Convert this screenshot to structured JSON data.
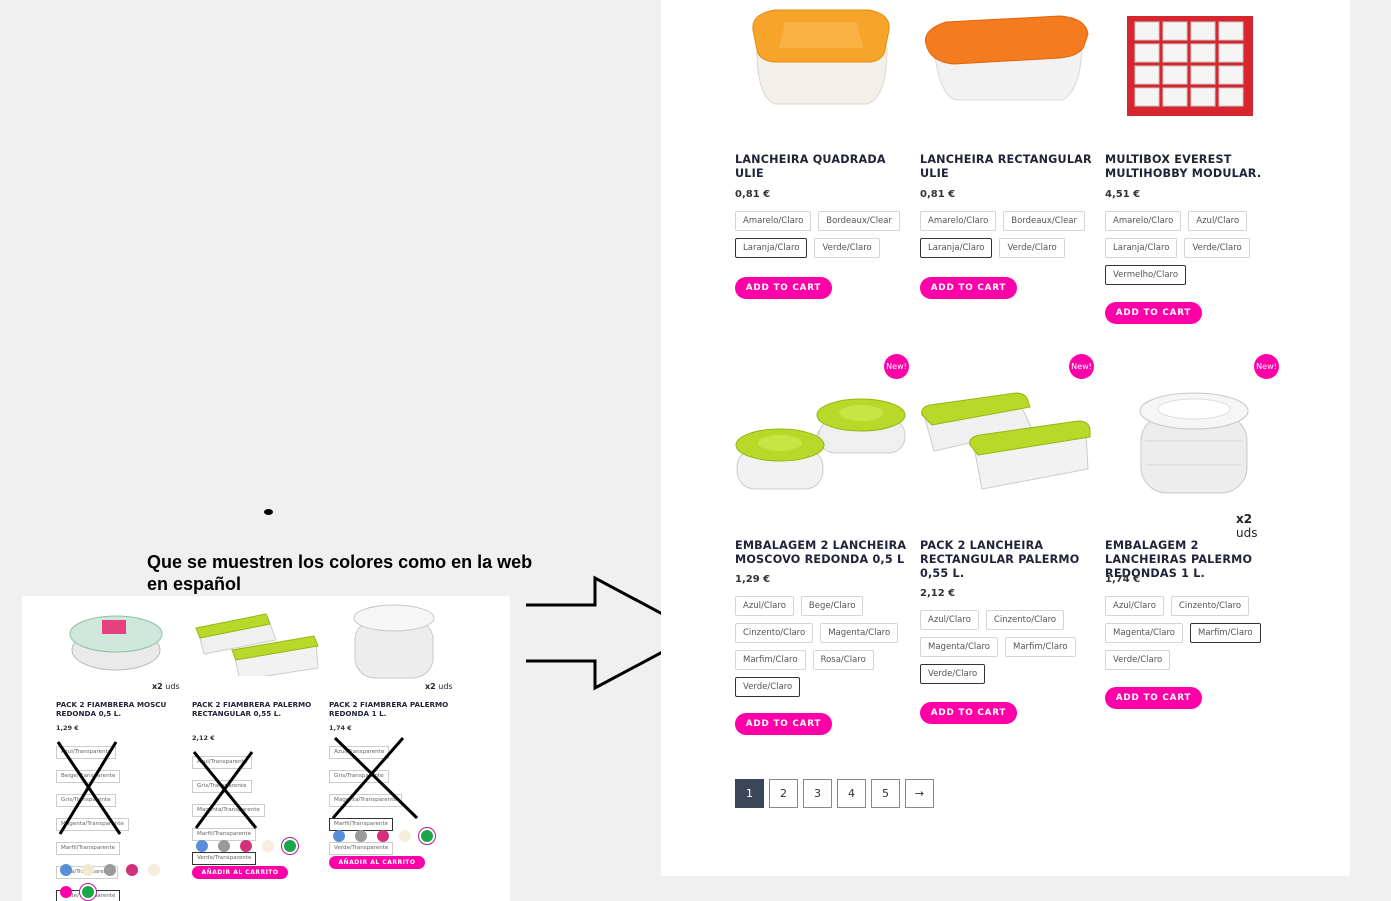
{
  "annotation": {
    "note": "Que se muestren los colores como en la web en español"
  },
  "products": [
    {
      "title": "LANCHEIRA QUADRADA ULIE",
      "price": "0,81 €",
      "colors": [
        "Amarelo/Claro",
        "Bordeaux/Clear",
        "Laranja/Claro",
        "Verde/Claro"
      ],
      "selected": "Laranja/Claro",
      "button": "ADD TO CART",
      "badge": ""
    },
    {
      "title": "LANCHEIRA RECTANGULAR ULIE",
      "price": "0,81 €",
      "colors": [
        "Amarelo/Claro",
        "Bordeaux/Clear",
        "Laranja/Claro",
        "Verde/Claro"
      ],
      "selected": "Laranja/Claro",
      "button": "ADD TO CART",
      "badge": ""
    },
    {
      "title": "MULTIBOX EVEREST MULTIHOBBY MODULAR.",
      "price": "4,51 €",
      "colors": [
        "Amarelo/Claro",
        "Azul/Claro",
        "Laranja/Claro",
        "Verde/Claro",
        "Vermelho/Claro"
      ],
      "selected": "Vermelho/Claro",
      "button": "ADD TO CART",
      "badge": ""
    },
    {
      "title": "EMBALAGEM 2 LANCHEIRA MOSCOVO REDONDA 0,5 L",
      "price": "1,29 €",
      "colors": [
        "Azul/Claro",
        "Bege/Claro",
        "Cinzento/Claro",
        "Magenta/Claro",
        "Marfim/Claro",
        "Rosa/Claro",
        "Verde/Claro"
      ],
      "selected": "Verde/Claro",
      "button": "ADD TO CART",
      "badge": "New!"
    },
    {
      "title": "PACK 2 LANCHEIRA RECTANGULAR PALERMO 0,55 L.",
      "price": "2,12 €",
      "colors": [
        "Azul/Claro",
        "Cinzento/Claro",
        "Magenta/Claro",
        "Marfim/Claro",
        "Verde/Claro"
      ],
      "selected": "Verde/Claro",
      "button": "ADD TO CART",
      "badge": "New!"
    },
    {
      "title": "EMBALAGEM 2 LANCHEIRAS PALERMO REDONDAS 1 L.",
      "price": "1,74 €",
      "colors": [
        "Azul/Claro",
        "Cinzento/Claro",
        "Magenta/Claro",
        "Marfim/Claro",
        "Verde/Claro"
      ],
      "selected": "Marfim/Claro",
      "button": "ADD TO CART",
      "badge": "New!",
      "uds_qty": "x2",
      "uds_unit": "uds"
    }
  ],
  "pagination": [
    "1",
    "2",
    "3",
    "4",
    "5",
    "→"
  ],
  "pagination_current": "1",
  "spanish_shot": {
    "products": [
      {
        "title": "PACK 2 FIAMBRERA MOSCU REDONDA 0,5 L.",
        "price": "1,29 €",
        "colors": [
          "Azul/Transparente",
          "Beige/Transparente",
          "Gris/Transparente",
          "Magenta/Transparente",
          "Marfil/Transparente",
          "Rosa/Transparente",
          "Verde/Transparente"
        ],
        "selected": "Verde/Transparente",
        "uds_qty": "x2",
        "uds_unit": "uds",
        "swatches": [
          "#5b8ed8",
          "#f3e8d0",
          "#9a9a9a",
          "#d2307a",
          "#f6eddc",
          "#ff00a8",
          "#19a74a"
        ]
      },
      {
        "title": "PACK 2 FIAMBRERA PALERMO RECTANGULAR 0,55 L.",
        "price": "2,12 €",
        "colors": [
          "Azul/Transparente",
          "Gris/Transparente",
          "Magenta/Transparente",
          "Marfil/Transparente",
          "Verde/Transparente"
        ],
        "selected": "Verde/Transparente",
        "button": "AÑADIR AL CARRITO",
        "swatches": [
          "#5b8ed8",
          "#9a9a9a",
          "#d2307a",
          "#f6eddc",
          "#19a74a"
        ]
      },
      {
        "title": "PACK 2 FIAMBRERA PALERMO REDONDA 1 L.",
        "price": "1,74 €",
        "colors": [
          "Azul/Transparente",
          "Gris/Transparente",
          "Magenta/Transparente",
          "Marfil/Transparente",
          "Verde/Transparente"
        ],
        "selected": "Marfil/Transparente",
        "button": "AÑADIR AL CARRITO",
        "uds_qty": "x2",
        "uds_unit": "uds",
        "swatches": [
          "#5b8ed8",
          "#9a9a9a",
          "#d2307a",
          "#f6eddc",
          "#19a74a"
        ]
      }
    ]
  },
  "colors": {
    "accent": "#ff00a8",
    "pager_active": "#3b4659",
    "title": "#1f2238"
  }
}
